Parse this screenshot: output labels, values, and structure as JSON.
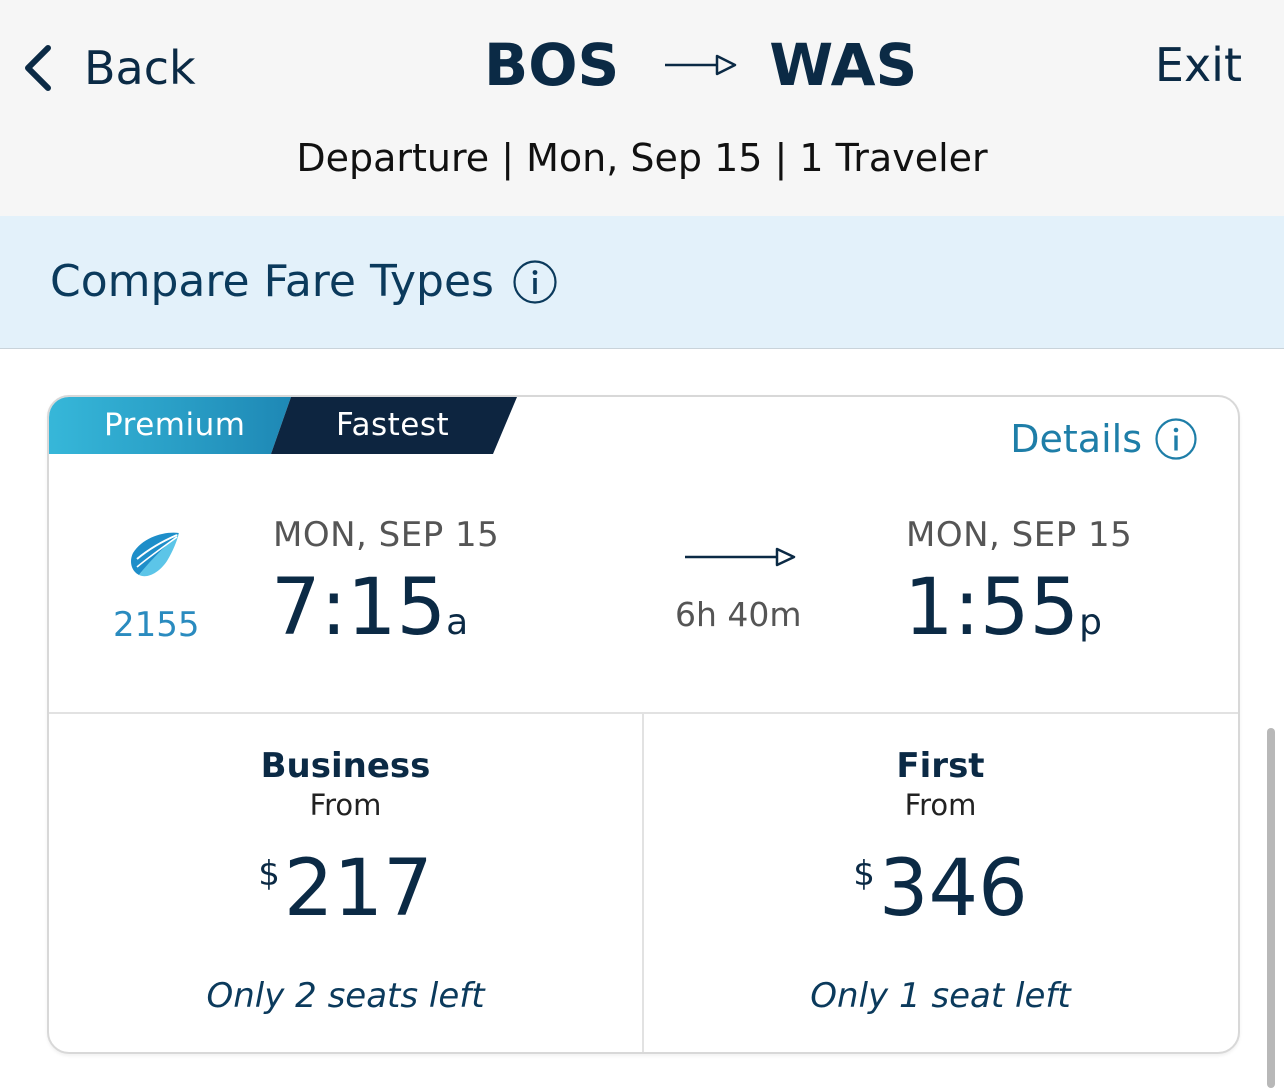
{
  "header": {
    "back_label": "Back",
    "origin": "BOS",
    "destination": "WAS",
    "exit_label": "Exit",
    "subtitle": "Departure | Mon, Sep 15 | 1 Traveler"
  },
  "compare": {
    "title": "Compare Fare Types"
  },
  "flight": {
    "tags": [
      "Premium",
      "Fastest"
    ],
    "details_label": "Details",
    "flight_number": "2155",
    "departure": {
      "date": "MON, SEP 15",
      "time": "7:15",
      "ampm": "a"
    },
    "arrival": {
      "date": "MON, SEP 15",
      "time": "1:55",
      "ampm": "p"
    },
    "duration": "6h 40m",
    "fares": [
      {
        "name": "Business",
        "from": "From",
        "currency": "$",
        "price": "217",
        "seats": "Only 2 seats left"
      },
      {
        "name": "First",
        "from": "From",
        "currency": "$",
        "price": "346",
        "seats": "Only 1 seat left"
      }
    ]
  },
  "colors": {
    "navy": "#0b2a45",
    "accent_blue": "#1e7ea8",
    "banner_bg": "#e3f1fa",
    "premium_tag": "#2ab0d6",
    "fastest_tag": "#0d2540"
  },
  "icons": {
    "back": "chevron-left-icon",
    "route": "arrow-right-icon",
    "info": "info-circle-icon",
    "airline": "airline-logo-icon"
  }
}
